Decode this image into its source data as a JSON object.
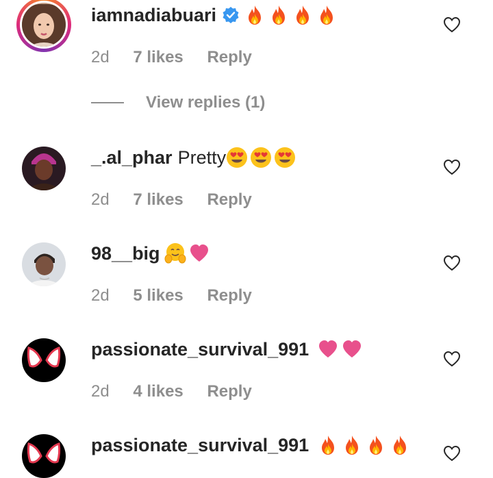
{
  "comments": [
    {
      "username": "iamnadiabuari",
      "verified": true,
      "text": "",
      "emojis": [
        "fire-emoji",
        "fire-emoji",
        "fire-emoji",
        "fire-emoji"
      ],
      "age": "2d",
      "likes": "7 likes",
      "reply": "Reply",
      "has_story": true
    },
    {
      "username": "_.al_phar",
      "verified": false,
      "text": "Pretty",
      "emojis": [
        "heart-eyes-emoji",
        "heart-eyes-emoji",
        "heart-eyes-emoji"
      ],
      "age": "2d",
      "likes": "7 likes",
      "reply": "Reply"
    },
    {
      "username": "98__big",
      "verified": false,
      "text": "",
      "emojis": [
        "hugging-face-emoji",
        "pink-heart-emoji"
      ],
      "age": "2d",
      "likes": "5 likes",
      "reply": "Reply"
    },
    {
      "username": "passionate_survival_991",
      "verified": false,
      "text": "",
      "emojis": [
        "pink-heart-emoji",
        "pink-heart-emoji"
      ],
      "age": "2d",
      "likes": "4 likes",
      "reply": "Reply"
    },
    {
      "username": "passionate_survival_991",
      "verified": false,
      "text": "",
      "emojis": [
        "fire-emoji",
        "fire-emoji",
        "fire-emoji",
        "fire-emoji"
      ]
    }
  ],
  "view_replies": "View replies (1)",
  "colors": {
    "text_primary": "#262626",
    "text_secondary": "#8e8e8e",
    "verified_blue": "#3897f0",
    "pink_heart": "#e8508c"
  }
}
